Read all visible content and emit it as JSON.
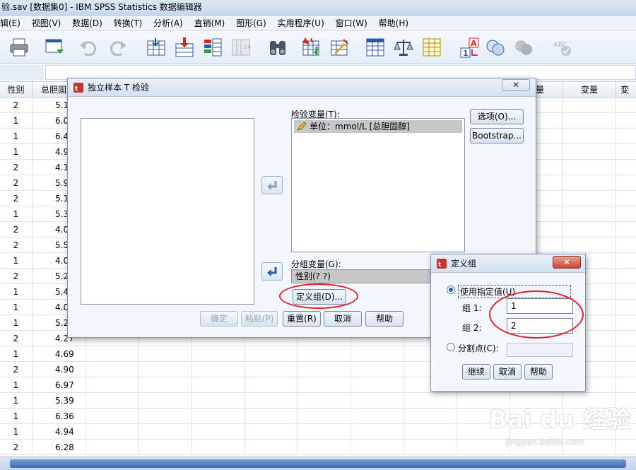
{
  "window": {
    "title": "验.sav [数据集0] - IBM SPSS Statistics 数据编辑器"
  },
  "menu": [
    "辑(E)",
    "视图(V)",
    "数据(D)",
    "转换(T)",
    "分析(A)",
    "直销(M)",
    "图形(G)",
    "实用程序(U)",
    "窗口(W)",
    "帮助(H)"
  ],
  "grid": {
    "columns": [
      "性别",
      "总胆固",
      "量",
      "变量",
      "变"
    ],
    "rows": [
      [
        "2",
        "5.1"
      ],
      [
        "1",
        "6.0"
      ],
      [
        "1",
        "6.4"
      ],
      [
        "1",
        "4.9"
      ],
      [
        "2",
        "4.1"
      ],
      [
        "2",
        "5.9"
      ],
      [
        "2",
        "5.1"
      ],
      [
        "1",
        "5.3"
      ],
      [
        "2",
        "4.0"
      ],
      [
        "2",
        "5.5"
      ],
      [
        "1",
        "4.0"
      ],
      [
        "2",
        "5.2"
      ],
      [
        "1",
        "5.4"
      ],
      [
        "1",
        "4.0"
      ],
      [
        "1",
        "5.2"
      ],
      [
        "2",
        "4.27"
      ],
      [
        "1",
        "4.69"
      ],
      [
        "2",
        "4.90"
      ],
      [
        "1",
        "6.97"
      ],
      [
        "1",
        "5.39"
      ],
      [
        "1",
        "6.36"
      ],
      [
        "1",
        "4.94"
      ],
      [
        "2",
        "6.28"
      ]
    ]
  },
  "dialog": {
    "title": "独立样本 T 检验",
    "close_label": "✕",
    "test_var_label": "检验变量(T):",
    "test_var_items": [
      "单位：mmol/L [总胆固醇]"
    ],
    "group_var_label": "分组变量(G):",
    "group_var_value": "性别(? ?)",
    "define_group_button": "定义组(D)...",
    "options_button": "选项(O)...",
    "bootstrap_button": "Bootstrap...",
    "ok_button": "确定",
    "paste_button": "粘贴(P)",
    "reset_button": "重置(R)",
    "cancel_button": "取消",
    "help_button": "帮助"
  },
  "define_group": {
    "title": "定义组",
    "use_specified_label": "使用指定值(U)",
    "group1_label": "组 1:",
    "group1_value": "1",
    "group2_label": "组 2:",
    "group2_value": "2",
    "cutpoint_label": "分割点(C):",
    "continue_button": "继续",
    "cancel_button": "取消",
    "help_button": "帮助"
  },
  "watermark": {
    "brand": "Bai  du 经验",
    "url": "jingyan.baidu.com"
  }
}
